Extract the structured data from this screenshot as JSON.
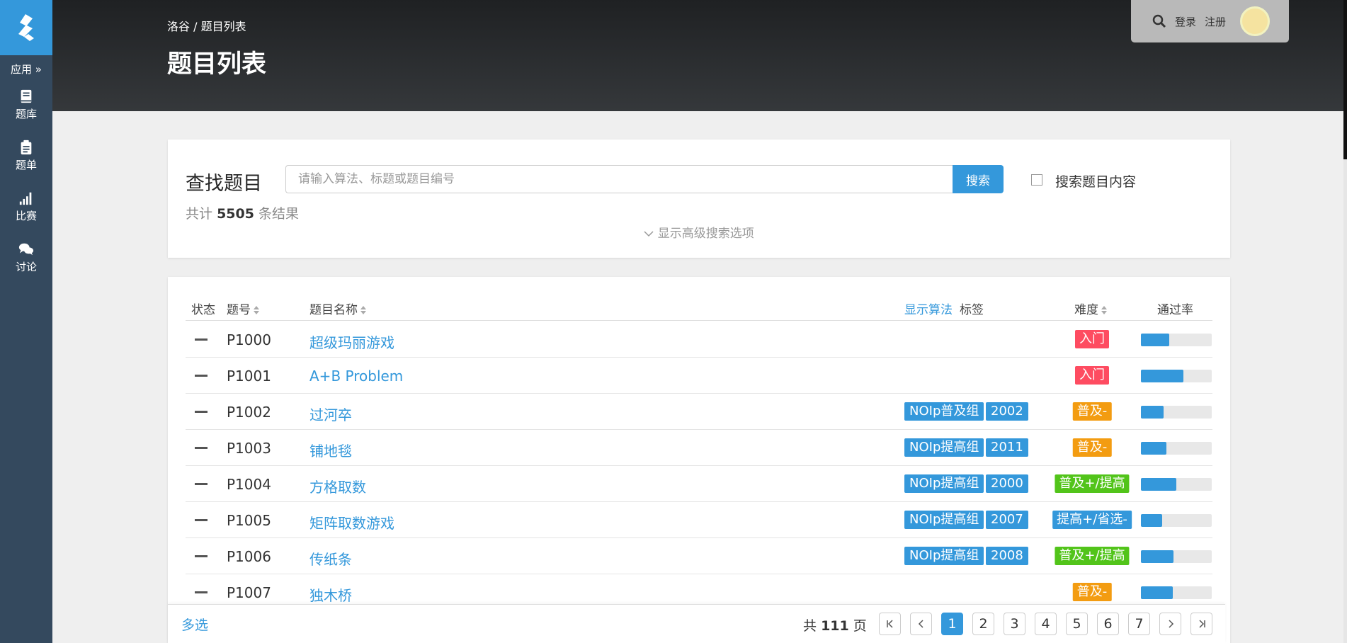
{
  "sidebar": {
    "app_label": "应用 »",
    "items": [
      {
        "label": "题库",
        "icon": "book-icon"
      },
      {
        "label": "题单",
        "icon": "clipboard-icon"
      },
      {
        "label": "比赛",
        "icon": "signal-bars-icon"
      },
      {
        "label": "讨论",
        "icon": "chat-bubbles-icon"
      }
    ]
  },
  "header": {
    "breadcrumb": "洛谷 / 题目列表",
    "title": "题目列表",
    "login": "登录",
    "register": "注册"
  },
  "search": {
    "label": "查找题目",
    "placeholder": "请输入算法、标题或题目编号",
    "button": "搜索",
    "checkbox_label": "搜索题目内容",
    "count_prefix": "共计",
    "count": "5505",
    "count_suffix": "条结果",
    "advanced_toggle": "显示高级搜索选项"
  },
  "table": {
    "headers": {
      "status": "状态",
      "pid": "题号",
      "name": "题目名称",
      "show_algo": "显示算法",
      "tags": "标签",
      "difficulty": "难度",
      "pass_rate": "通过率"
    },
    "rows": [
      {
        "pid": "P1000",
        "name": "超级玛丽游戏",
        "tags": [],
        "difficulty": "入门",
        "diff_color": "#fe4c61",
        "rate": 0.4
      },
      {
        "pid": "P1001",
        "name": "A+B Problem",
        "tags": [],
        "difficulty": "入门",
        "diff_color": "#fe4c61",
        "rate": 0.6
      },
      {
        "pid": "P1002",
        "name": "过河卒",
        "tags": [
          "NOIp普及组",
          "2002"
        ],
        "difficulty": "普及-",
        "diff_color": "#f39c11",
        "rate": 0.32
      },
      {
        "pid": "P1003",
        "name": "铺地毯",
        "tags": [
          "NOIp提高组",
          "2011"
        ],
        "difficulty": "普及-",
        "diff_color": "#f39c11",
        "rate": 0.36
      },
      {
        "pid": "P1004",
        "name": "方格取数",
        "tags": [
          "NOIp提高组",
          "2000"
        ],
        "difficulty": "普及+/提高",
        "diff_color": "#52c41a",
        "rate": 0.5
      },
      {
        "pid": "P1005",
        "name": "矩阵取数游戏",
        "tags": [
          "NOIp提高组",
          "2007"
        ],
        "difficulty": "提高+/省选-",
        "diff_color": "#3498db",
        "rate": 0.3
      },
      {
        "pid": "P1006",
        "name": "传纸条",
        "tags": [
          "NOIp提高组",
          "2008"
        ],
        "difficulty": "普及+/提高",
        "diff_color": "#52c41a",
        "rate": 0.46
      },
      {
        "pid": "P1007",
        "name": "独木桥",
        "tags": [],
        "difficulty": "普及-",
        "diff_color": "#f39c11",
        "rate": 0.45
      }
    ]
  },
  "footer": {
    "multi_select": "多选",
    "total_prefix": "共",
    "total_pages": "111",
    "total_suffix": "页",
    "pages": [
      "1",
      "2",
      "3",
      "4",
      "5",
      "6",
      "7"
    ],
    "current_page": "1"
  },
  "colors": {
    "accent": "#3498db",
    "sidebar": "#34495e",
    "diff_intro": "#fe4c61",
    "diff_popular_minus": "#f39c11",
    "diff_popular_plus": "#52c41a",
    "diff_improve_plus": "#3498db"
  }
}
